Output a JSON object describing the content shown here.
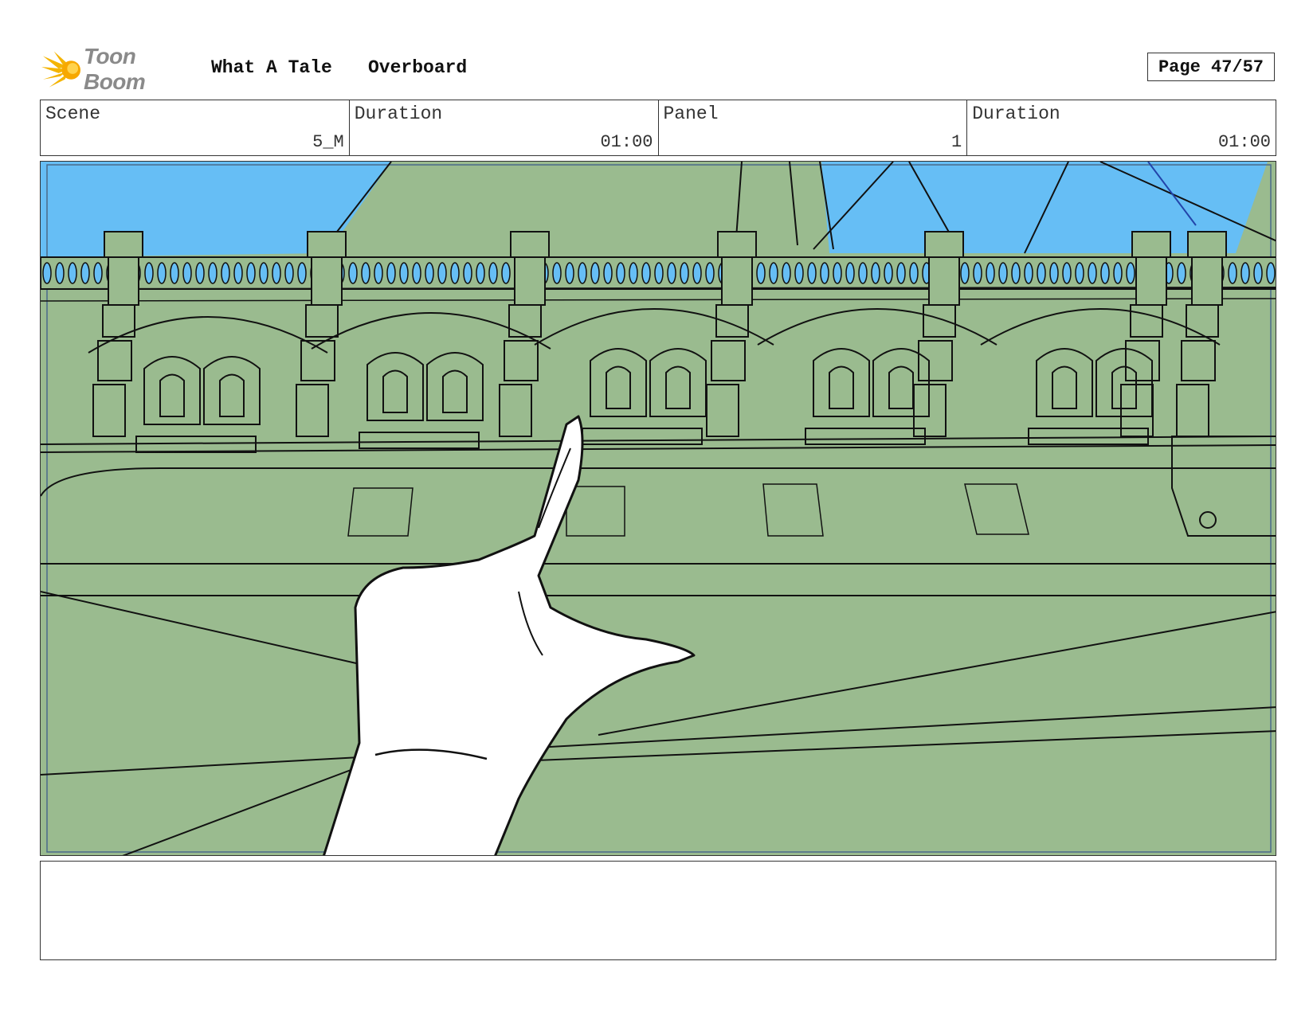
{
  "header": {
    "logo_text": "Toon Boom",
    "project_title": "What A Tale",
    "episode_title": "Overboard",
    "page_label": "Page 47/57"
  },
  "info": {
    "scene_label": "Scene",
    "scene_value": "5_M",
    "scene_duration_label": "Duration",
    "scene_duration_value": "01:00",
    "panel_label": "Panel",
    "panel_value": "1",
    "panel_duration_label": "Duration",
    "panel_duration_value": "01:00"
  },
  "panel_image": {
    "subject": "hand-pointing-at-building",
    "colors": {
      "sky": "#66bef5",
      "building": "#9abb8f",
      "hand": "#ffffff",
      "ink": "#111111"
    }
  },
  "notes": {
    "text": ""
  },
  "icons": {
    "logo": "toon-boom-logo-icon"
  }
}
